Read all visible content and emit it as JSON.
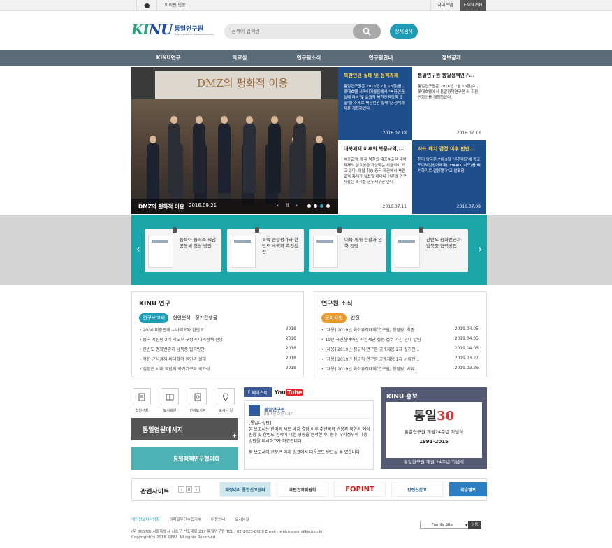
{
  "topbar": {
    "login": "아이핀 인증",
    "sitemap": "사이트맵",
    "english": "ENGLISH"
  },
  "logo": {
    "mark_a": "KI",
    "mark_b": "NU",
    "name": "통일연구원",
    "name_en": "Korea Institute for National Unification"
  },
  "search": {
    "placeholder": "검색어 입력란",
    "detail": "상세검색"
  },
  "gnb": [
    "KINU연구",
    "자료실",
    "연구원소식",
    "연구원안내",
    "정보공개"
  ],
  "hero": {
    "banner_text": "DMZ의 평화적 이용",
    "caption_title": "DMZ의 평화적 이용",
    "caption_date": "2016.09.21",
    "prev": "‹",
    "pause": "II",
    "next": "›"
  },
  "tiles": [
    {
      "title": "북한인권 실태 및 정책과제",
      "body": "통일연구원은 2016년 7월 18일(월), 롯데호텔 사파이어볼룸에서 \"북한인권 실태 파악 및 효과적 북한인권정책 도출\"을 주제로 북한인권 실태 및 정책과제를 개최하였다.",
      "date": "2016.07.18",
      "bg": "#1f4e8c",
      "fg": "#ffffff",
      "accent": "#ffd24a"
    },
    {
      "title": "통일연구원 통일정책연구...",
      "body": "통일연구원은 2016년 7월 13일(수), 롯데호텔에서 통일정책연구원 외 회장단회의를 개최하였다.",
      "date": "2016.07.13",
      "bg": "#ffffff",
      "fg": "#333333",
      "accent": "#222222"
    },
    {
      "title": "대북제재 이후의 북중교역,...",
      "body": "북중교역, 특히 북한의 대중수출은 대북제재의 실효성을 가능하는 시금석이 되고 있다. 이럴 취승 중국 하곤에서 북중교역 통계가 발표될 때마다 언론과 연구자들은 촉각을 곤두세우곤 한다.",
      "date": "2016.07.11",
      "bg": "#ffffff",
      "fg": "#333333",
      "accent": "#222222"
    },
    {
      "title": "사드 배치 결정 이후 한반...",
      "body": "한미 양국은 7월 8일 \"주한미군에 종고도미사일방어체계(THAAD, 사드)를 배치하기로 결정했다\"고 발표함",
      "date": "2016.07.08",
      "bg": "#1f4e8c",
      "fg": "#ffffff",
      "accent": "#ffd24a"
    }
  ],
  "books": [
    "동북아 플러스 책임공동체 형성 방안",
    "북핵 종합평가와 한반도 비핵화 촉진전략",
    "대북 제재 현황과 완화 전망",
    "한반도 평화번영과 남북중 협력방안"
  ],
  "kinu_research": {
    "title": "KINU 연구",
    "tabs": [
      "연구보고서",
      "현안분석",
      "정기간행물"
    ],
    "items": [
      {
        "t": "2030 미중관계 시나리오와 한반도",
        "d": "2018"
      },
      {
        "t": "중국 시진핑 2기 지도부 구성과 대외정책 전망",
        "d": "2018"
      },
      {
        "t": "한반도 평화번영과 남북중 협력방안",
        "d": "2018"
      },
      {
        "t": "북한 군사경제 비대화의 원인과 실태",
        "d": "2018"
      },
      {
        "t": "김정은 시대 북한의 국가기구와 국가성",
        "d": "2018"
      }
    ]
  },
  "news": {
    "title": "연구원 소식",
    "tabs": [
      "공지사항",
      "법진"
    ],
    "items": [
      {
        "t": "[채용] 2019년 육아휴직대체(연구원, 행정원) 최종...",
        "d": "2019.04.05"
      },
      {
        "t": "19년 국민참여예산 사업제안 접중 접수 기간 안내 알림",
        "d": "2019.04.05"
      },
      {
        "t": "[채용] 2019년 정규직 연구원 공개채용 2차 필기전...",
        "d": "2019.04.05"
      },
      {
        "t": "[채용] 2019년 정규직 연구원 공개채용 1차 서류전...",
        "d": "2019.03.27"
      },
      {
        "t": "[채용] 2019년 육아휴직대체(연구원, 행정원) 서류...",
        "d": "2019.03.26"
      }
    ]
  },
  "quick": [
    "합천신청",
    "도서회원",
    "전자도서관",
    "오시는 길"
  ],
  "banners": {
    "a": "통일염원메시지",
    "b": "통일정책연구협의회"
  },
  "facebook": {
    "tab": "페이스북",
    "youtube_a": "You",
    "youtube_b": "Tube",
    "page": "통일연구원",
    "time": "8월 5일 오전 3:37 · ",
    "tag": "[통일나침반]",
    "body1": "본 보고서는 한미의 사드 배치 결정 이후 주변국의 반응과 북한의 예상 반응 및 한반도 정세에 대한 영향을 분석한 후, 향후 우리정부의 대응 방안을 제시하고자 하였습니다.",
    "body2": "본 보고서의 전문은 아래 링크에서 다운로드 받으실 수 있습니다."
  },
  "promo": {
    "title": "KINU 홍보",
    "big_a": "통일",
    "big_b": "30",
    "line1": "통일연구원 개원24주년 기념식",
    "line2": "1991-2015",
    "line3": "통일연구원 개원 24주년 기념식"
  },
  "related": {
    "title": "관련사이트",
    "prev": "‹",
    "pause": "II",
    "next": "›",
    "logos": [
      "재정비리 통합신고센터",
      "국민권익위원회",
      "FOPINT",
      "안전신문고",
      "국방엘프"
    ]
  },
  "footer": {
    "links": [
      "개인정보처리방침",
      "이메일무단수집거부",
      "이용안내",
      "오시는길"
    ],
    "address": "(우 06578) 서울특별시 서초구 반포대로 217 통일연구원 TEL : 02-2023-8000 Email : webmaster@kinu.or.kr",
    "copyright": "Copyright(c) 2016 KINU. All rights Reserved.",
    "family": "Family Site",
    "go": "이동"
  }
}
